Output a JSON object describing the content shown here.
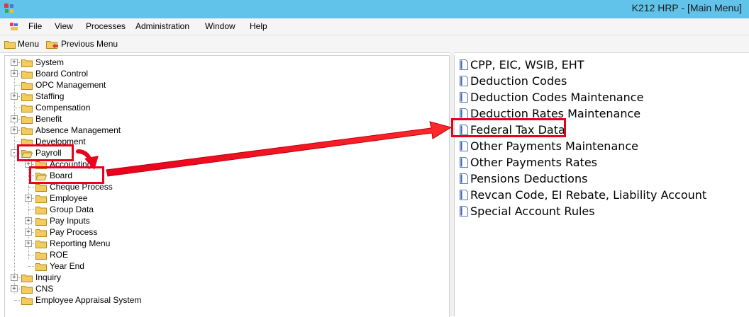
{
  "window": {
    "title": "K212 HRP - [Main Menu]"
  },
  "menubar": {
    "items": [
      "File",
      "View",
      "Processes",
      "Administration",
      "Window",
      "Help"
    ]
  },
  "toolbar": {
    "menu_label": "Menu",
    "previous_label": "Previous Menu"
  },
  "tree": {
    "top": [
      "System",
      "Board Control",
      "OPC Management",
      "Staffing",
      "Compensation",
      "Benefit",
      "Absence Management",
      "Development",
      "Payroll"
    ],
    "payroll_children": [
      "Accounting",
      "Board",
      "Cheque Process",
      "Employee",
      "Group Data",
      "Pay Inputs",
      "Pay Process",
      "Reporting Menu",
      "ROE",
      "Year End"
    ],
    "bottom": [
      "Inquiry",
      "CNS",
      "Employee Appraisal System"
    ]
  },
  "list": {
    "items": [
      "CPP, EIC, WSIB, EHT",
      "Deduction Codes",
      "Deduction Codes Maintenance",
      "Deduction Rates Maintenance",
      "Federal Tax Data",
      "Other Payments Maintenance",
      "Other Payments Rates",
      "Pensions Deductions",
      "Revcan Code, EI Rebate, Liability Account",
      "Special Account Rules"
    ]
  },
  "colors": {
    "titlebar": "#62c3ea",
    "annotation": "#e8001c",
    "folder": "#f3cb5e"
  }
}
